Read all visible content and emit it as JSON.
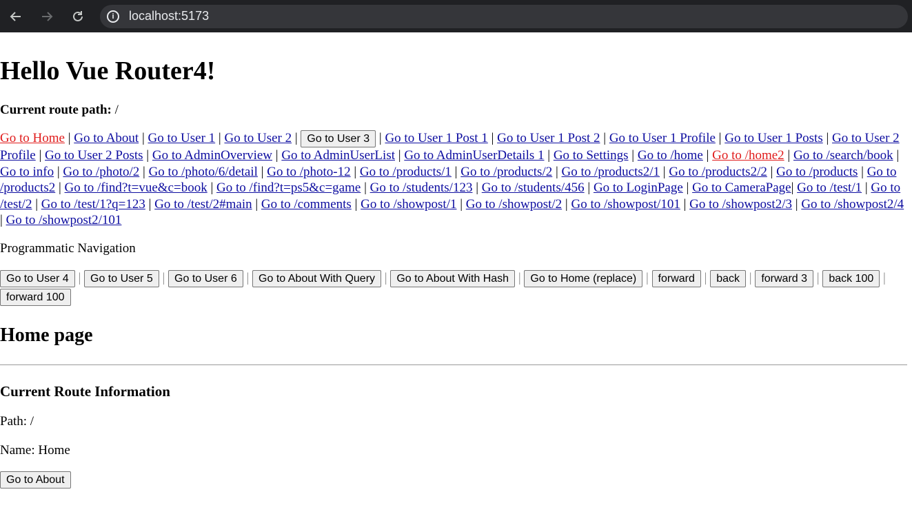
{
  "browser": {
    "back_icon": "arrow-left",
    "forward_icon": "arrow-right",
    "reload_icon": "reload",
    "url": "localhost:5173"
  },
  "page": {
    "title": "Hello Vue Router4!",
    "current_route_label": "Current route path:",
    "current_route_value": "/",
    "links": [
      {
        "text": "Go to Home",
        "active": true
      },
      {
        "text": "Go to About"
      },
      {
        "text": "Go to User 1"
      },
      {
        "text": "Go to User 2"
      },
      {
        "text": "Go to User 3",
        "button": true
      },
      {
        "text": "Go to User 1 Post 1"
      },
      {
        "text": "Go to User 1 Post 2"
      },
      {
        "text": "Go to User 1 Profile"
      },
      {
        "text": "Go to User 1 Posts"
      },
      {
        "text": "Go to User 2 Profile"
      },
      {
        "text": "Go to User 2 Posts"
      },
      {
        "text": "Go to AdminOverview"
      },
      {
        "text": "Go to AdminUserList"
      },
      {
        "text": "Go to AdminUserDetails 1"
      },
      {
        "text": "Go to Settings"
      },
      {
        "text": "Go to /home"
      },
      {
        "text": "Go to /home2",
        "active": true
      },
      {
        "text": "Go to /search/book"
      },
      {
        "text": "Go to info"
      },
      {
        "text": "Go to /photo/2"
      },
      {
        "text": "Go to /photo/6/detail"
      },
      {
        "text": "Go to /photo-12"
      },
      {
        "text": "Go to /products/1"
      },
      {
        "text": "Go to /products/2"
      },
      {
        "text": "Go to /products2/1"
      },
      {
        "text": "Go to /products2/2"
      },
      {
        "text": "Go to /products"
      },
      {
        "text": "Go to /products2"
      },
      {
        "text": "Go to /find?t=vue&c=book"
      },
      {
        "text": "Go to /find?t=ps5&c=game"
      },
      {
        "text": "Go to /students/123"
      },
      {
        "text": "Go to /students/456"
      },
      {
        "text": "Go to LoginPage"
      },
      {
        "text": "Go to CameraPage",
        "no_space": true
      },
      {
        "text": "Go to /test/1"
      },
      {
        "text": "Go to /test/2"
      },
      {
        "text": "Go to /test/1?q=123"
      },
      {
        "text": "Go to /test/2#main"
      },
      {
        "text": "Go to /comments"
      },
      {
        "text": "Go to /showpost/1"
      },
      {
        "text": "Go to /showpost/2"
      },
      {
        "text": "Go to /showpost/101"
      },
      {
        "text": "Go to /showpost2/3"
      },
      {
        "text": "Go to /showpost2/4"
      },
      {
        "text": "Go to /showpost2/101"
      }
    ],
    "separator": "|",
    "programmatic_title": "Programmatic Navigation",
    "programmatic_buttons": [
      "Go to User 4",
      "Go to User 5",
      "Go to User 6",
      "Go to About With Query",
      "Go to About With Hash",
      "Go to Home (replace)",
      "forward",
      "back",
      "forward 3",
      "back 100",
      "forward 100"
    ],
    "home_heading": "Home page",
    "route_info_heading": "Current Route Information",
    "path_line": "Path: /",
    "name_line": "Name: Home",
    "about_button": "Go to About"
  }
}
